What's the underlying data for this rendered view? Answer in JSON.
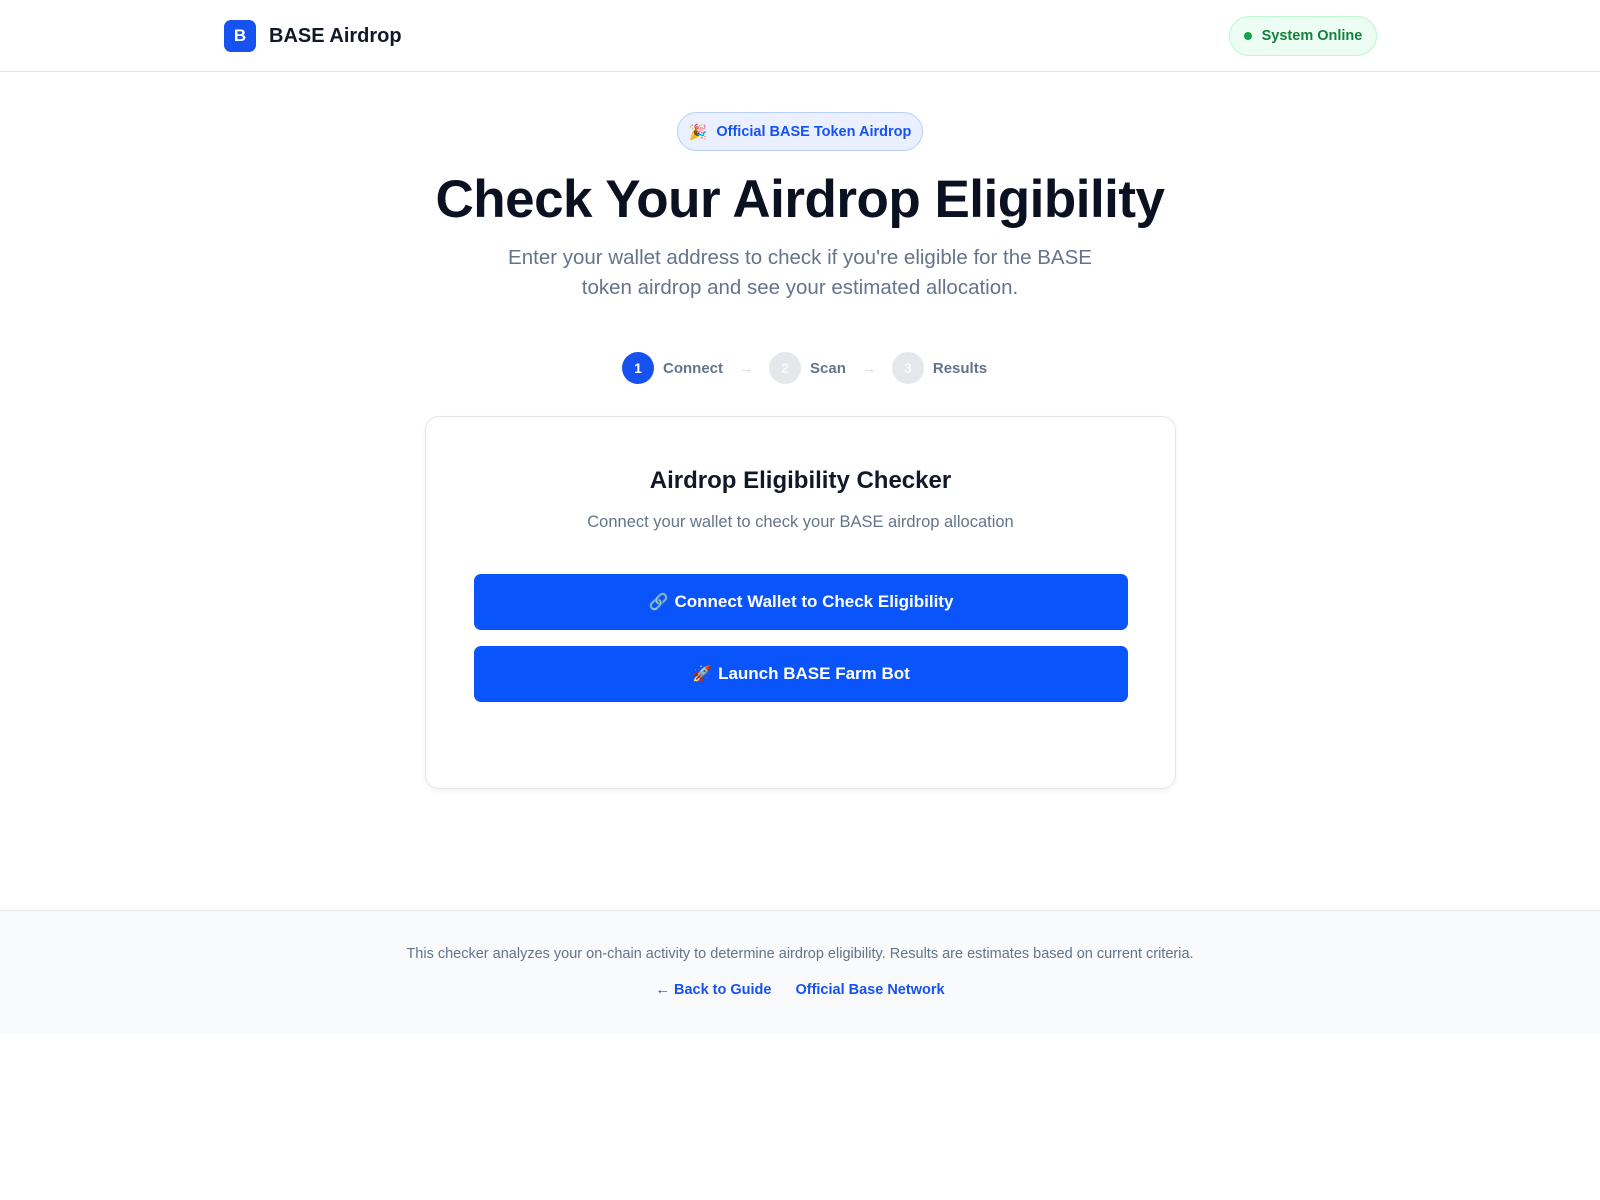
{
  "header": {
    "logo_letter": "B",
    "brand_name": "BASE Airdrop",
    "status": "System Online"
  },
  "hero": {
    "badge_icon": "🎉",
    "badge_text": "Official BASE Token Airdrop",
    "title": "Check Your Airdrop Eligibility",
    "subtitle": "Enter your wallet address to check if you're eligible for the BASE token airdrop and see your estimated allocation."
  },
  "steps": [
    {
      "number": "1",
      "label": "Connect",
      "state": "active"
    },
    {
      "number": "2",
      "label": "Scan",
      "state": "inactive"
    },
    {
      "number": "3",
      "label": "Results",
      "state": "inactive"
    }
  ],
  "step_arrow": "→",
  "card": {
    "title": "Airdrop Eligibility Checker",
    "subtitle": "Connect your wallet to check your BASE airdrop allocation",
    "connect_icon": "🔗",
    "connect_label": "Connect Wallet to Check Eligibility",
    "launch_icon": "🚀",
    "launch_label": "Launch BASE Farm Bot"
  },
  "footer": {
    "text": "This checker analyzes your on-chain activity to determine airdrop eligibility. Results are estimates based on current criteria.",
    "links": [
      {
        "label": "← Back to Guide"
      },
      {
        "label": "Official Base Network"
      }
    ]
  },
  "colors": {
    "primary": "#1652f0",
    "button": "#0a55fb",
    "status_green": "#15803d",
    "muted_text": "#64748b"
  }
}
